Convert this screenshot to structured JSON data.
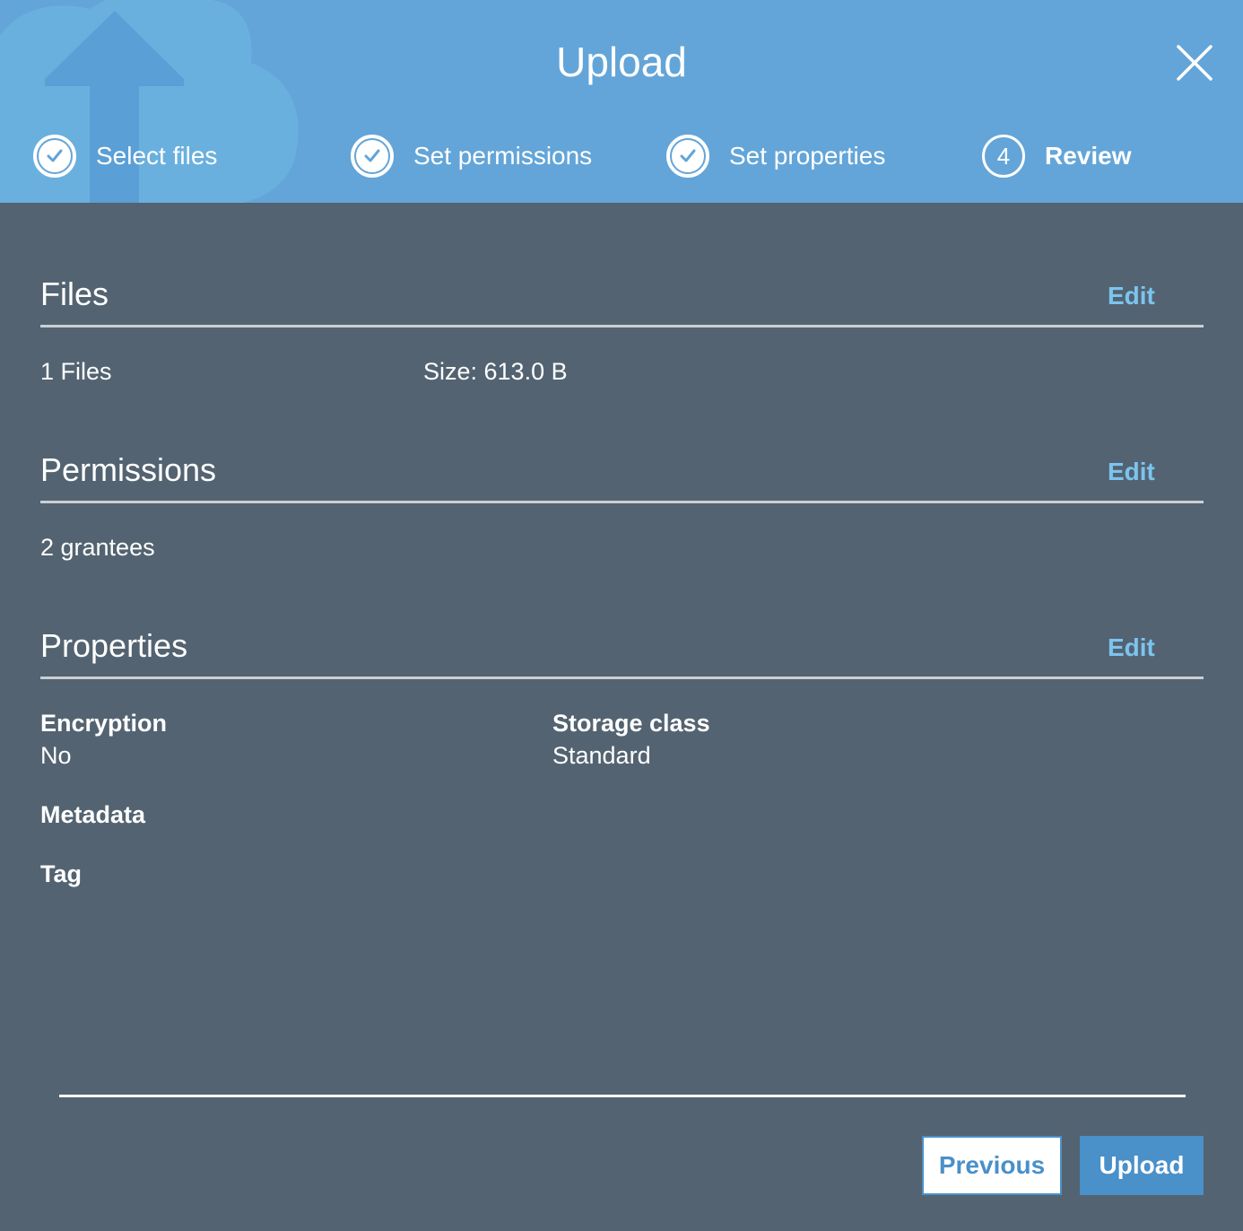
{
  "header": {
    "title": "Upload",
    "steps": [
      {
        "label": "Select files",
        "state": "complete"
      },
      {
        "label": "Set permissions",
        "state": "complete"
      },
      {
        "label": "Set properties",
        "state": "complete"
      },
      {
        "label": "Review",
        "state": "current",
        "number": "4"
      }
    ]
  },
  "sections": {
    "files": {
      "title": "Files",
      "edit_label": "Edit",
      "count": "1 Files",
      "size": "Size: 613.0 B"
    },
    "permissions": {
      "title": "Permissions",
      "edit_label": "Edit",
      "grantees": "2 grantees"
    },
    "properties": {
      "title": "Properties",
      "edit_label": "Edit",
      "encryption_label": "Encryption",
      "encryption_value": "No",
      "storage_class_label": "Storage class",
      "storage_class_value": "Standard",
      "metadata_label": "Metadata",
      "tag_label": "Tag"
    }
  },
  "footer": {
    "previous_label": "Previous",
    "upload_label": "Upload"
  },
  "colors": {
    "header_bg": "#63a5d8",
    "body_bg": "#536371",
    "link": "#7cc4ef",
    "primary_button": "#4a90c9"
  },
  "icons": {
    "close": "close-icon",
    "step_complete": "checkmark-icon",
    "background": "cloud-upload-icon"
  }
}
